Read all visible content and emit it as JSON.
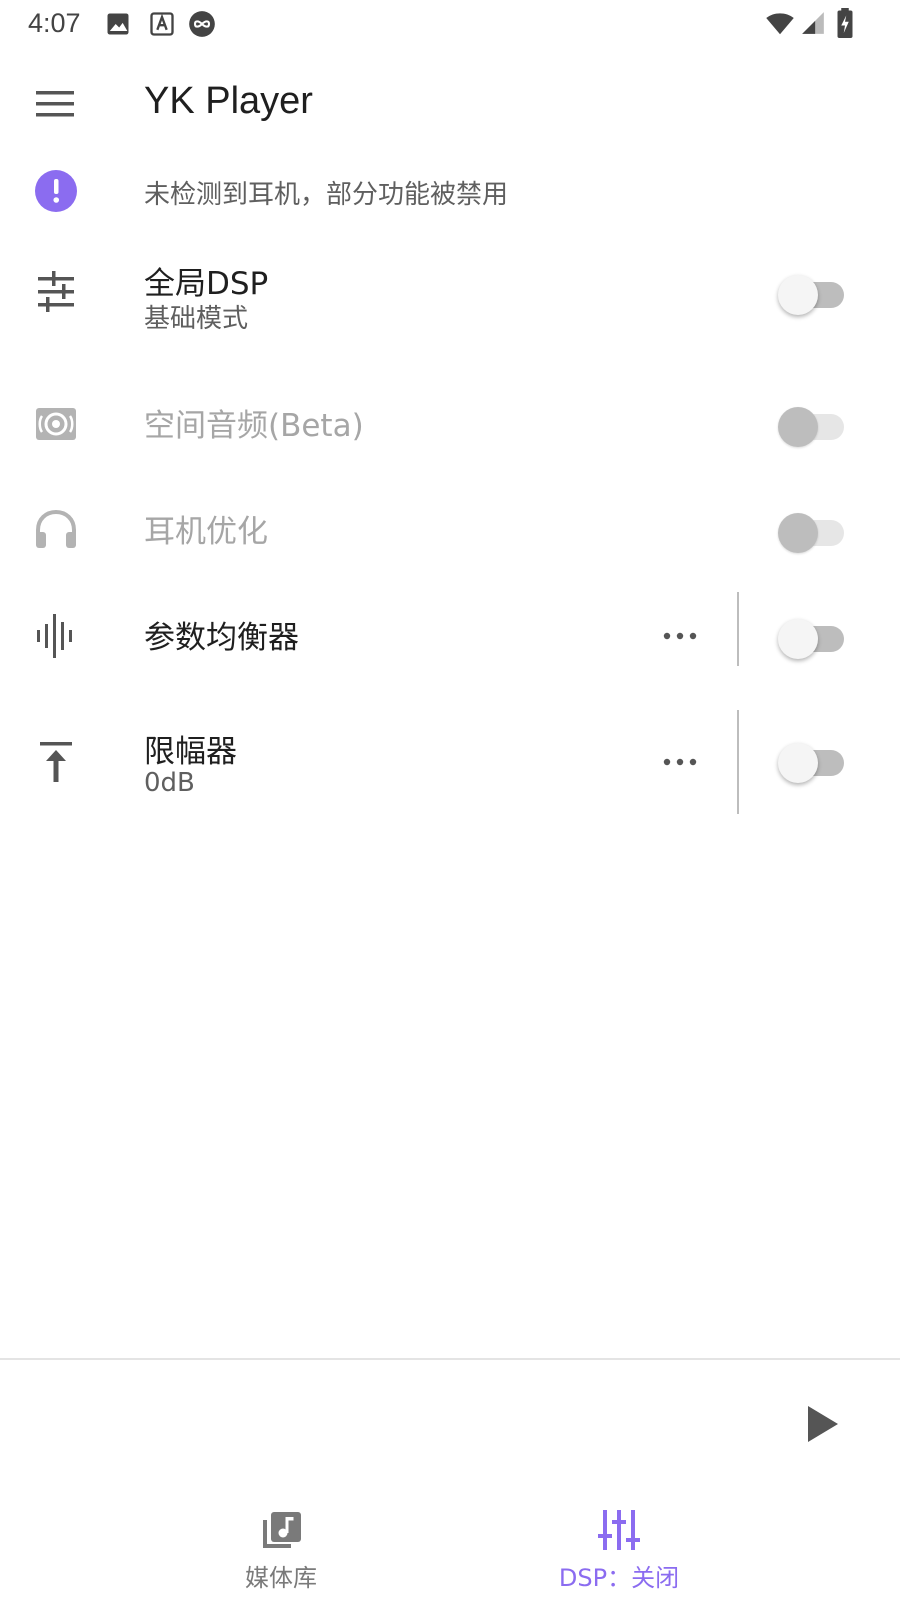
{
  "status_bar": {
    "time": "4:07",
    "icons": [
      "image-icon",
      "a-notification-icon",
      "infinity-icon",
      "wifi-icon",
      "signal-icon",
      "battery-charging-icon"
    ]
  },
  "app_bar": {
    "title": "YK Player",
    "menu_icon": "hamburger-menu-icon"
  },
  "warning": {
    "icon": "alert-circle-icon",
    "text": "未检测到耳机，部分功能被禁用",
    "color": "#8b6cf0"
  },
  "settings": [
    {
      "key": "global_dsp",
      "icon": "tune-sliders-icon",
      "title": "全局DSP",
      "subtitle": "基础模式",
      "enabled": false,
      "disabled": false,
      "has_more": false
    },
    {
      "key": "spatial_audio",
      "icon": "spatial-audio-icon",
      "title": "空间音频(Beta)",
      "subtitle": "",
      "enabled": false,
      "disabled": true,
      "has_more": false
    },
    {
      "key": "headphone_opt",
      "icon": "headphones-icon",
      "title": "耳机优化",
      "subtitle": "",
      "enabled": false,
      "disabled": true,
      "has_more": false
    },
    {
      "key": "parametric_eq",
      "icon": "waveform-icon",
      "title": "参数均衡器",
      "subtitle": "",
      "enabled": false,
      "disabled": false,
      "has_more": true
    },
    {
      "key": "limiter",
      "icon": "upload-arrow-icon",
      "title": "限幅器",
      "subtitle": "0dB",
      "enabled": false,
      "disabled": false,
      "has_more": true
    }
  ],
  "player": {
    "play_icon": "play-icon"
  },
  "bottom_nav": {
    "items": [
      {
        "label": "媒体库",
        "icon": "library-music-icon",
        "active": false
      },
      {
        "label": "DSP：关闭",
        "icon": "equalizer-sliders-icon",
        "active": true
      }
    ],
    "accent": "#8b6cf0"
  }
}
